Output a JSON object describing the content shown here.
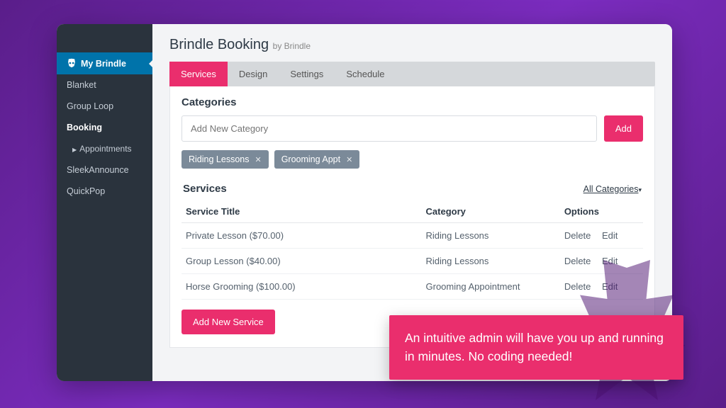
{
  "header": {
    "title": "Brindle Booking",
    "byline": "by Brindle"
  },
  "sidebar": {
    "items": [
      {
        "label": "My Brindle",
        "active": true
      },
      {
        "label": "Blanket"
      },
      {
        "label": "Group Loop"
      },
      {
        "label": "Booking",
        "bold": true
      },
      {
        "label": "Appointments",
        "sub": true
      },
      {
        "label": "SleekAnnounce"
      },
      {
        "label": "QuickPop"
      }
    ]
  },
  "tabs": [
    {
      "label": "Services",
      "active": true
    },
    {
      "label": "Design"
    },
    {
      "label": "Settings"
    },
    {
      "label": "Schedule"
    }
  ],
  "categories": {
    "heading": "Categories",
    "placeholder": "Add New Category",
    "add_label": "Add",
    "chips": [
      "Riding Lessons",
      "Grooming Appt"
    ]
  },
  "services": {
    "heading": "Services",
    "filter_label": "All Categories",
    "columns": {
      "title": "Service Title",
      "category": "Category",
      "options": "Options"
    },
    "rows": [
      {
        "title": "Private Lesson ($70.00)",
        "category": "Riding Lessons"
      },
      {
        "title": "Group Lesson ($40.00)",
        "category": "Riding Lessons"
      },
      {
        "title": "Horse Grooming ($100.00)",
        "category": "Grooming Appointment"
      }
    ],
    "option_delete": "Delete",
    "option_edit": "Edit",
    "add_label": "Add New Service"
  },
  "promo": {
    "text": "An intuitive admin will have you up and running in minutes. No coding needed!"
  }
}
